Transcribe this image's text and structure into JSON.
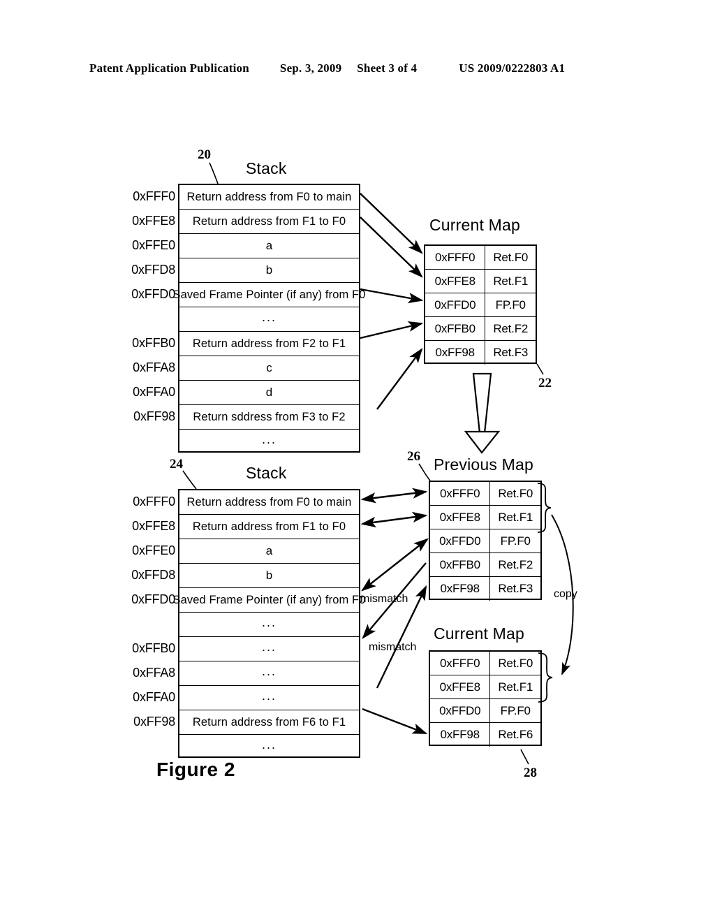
{
  "header": {
    "publication": "Patent Application Publication",
    "date": "Sep. 3, 2009",
    "sheet": "Sheet 3 of 4",
    "doc_number": "US 2009/0222803 A1"
  },
  "figure": {
    "caption": "Figure 2"
  },
  "top_stack": {
    "title": "Stack",
    "ref": "20",
    "rows": [
      {
        "addr": "0xFFF0",
        "text": "Return address from F0 to main"
      },
      {
        "addr": "0xFFE8",
        "text": "Return address from F1 to F0"
      },
      {
        "addr": "0xFFE0",
        "text": "a"
      },
      {
        "addr": "0xFFD8",
        "text": "b"
      },
      {
        "addr": "0xFFD0",
        "text": "Saved Frame Pointer (if any) from F0"
      },
      {
        "addr": "",
        "text": "..."
      },
      {
        "addr": "0xFFB0",
        "text": "Return address from F2 to F1"
      },
      {
        "addr": "0xFFA8",
        "text": "c"
      },
      {
        "addr": "0xFFA0",
        "text": "d"
      },
      {
        "addr": "0xFF98",
        "text": "Return sddress from F3 to F2"
      },
      {
        "addr": "",
        "text": "..."
      }
    ]
  },
  "top_current_map": {
    "title": "Current Map",
    "ref": "22",
    "rows": [
      {
        "addr": "0xFFF0",
        "value": "Ret.F0"
      },
      {
        "addr": "0xFFE8",
        "value": "Ret.F1"
      },
      {
        "addr": "0xFFD0",
        "value": "FP.F0"
      },
      {
        "addr": "0xFFB0",
        "value": "Ret.F2"
      },
      {
        "addr": "0xFF98",
        "value": "Ret.F3"
      }
    ]
  },
  "bottom_stack": {
    "title": "Stack",
    "ref": "24",
    "rows": [
      {
        "addr": "0xFFF0",
        "text": "Return address from F0 to main"
      },
      {
        "addr": "0xFFE8",
        "text": "Return address from F1 to F0"
      },
      {
        "addr": "0xFFE0",
        "text": "a"
      },
      {
        "addr": "0xFFD8",
        "text": "b"
      },
      {
        "addr": "0xFFD0",
        "text": "Saved Frame Pointer (if any) from F0"
      },
      {
        "addr": "",
        "text": "..."
      },
      {
        "addr": "0xFFB0",
        "text": "..."
      },
      {
        "addr": "0xFFA8",
        "text": "..."
      },
      {
        "addr": "0xFFA0",
        "text": "..."
      },
      {
        "addr": "0xFF98",
        "text": "Return address from F6 to F1"
      },
      {
        "addr": "",
        "text": "..."
      }
    ]
  },
  "previous_map": {
    "title": "Previous Map",
    "ref": "26",
    "rows": [
      {
        "addr": "0xFFF0",
        "value": "Ret.F0"
      },
      {
        "addr": "0xFFE8",
        "value": "Ret.F1"
      },
      {
        "addr": "0xFFD0",
        "value": "FP.F0"
      },
      {
        "addr": "0xFFB0",
        "value": "Ret.F2"
      },
      {
        "addr": "0xFF98",
        "value": "Ret.F3"
      }
    ]
  },
  "bottom_current_map": {
    "title": "Current Map",
    "ref": "28",
    "rows": [
      {
        "addr": "0xFFF0",
        "value": "Ret.F0"
      },
      {
        "addr": "0xFFE8",
        "value": "Ret.F1"
      },
      {
        "addr": "0xFFD0",
        "value": "FP.F0"
      },
      {
        "addr": "0xFF98",
        "value": "Ret.F6"
      }
    ]
  },
  "annotations": {
    "mismatch_upper": "mismatch",
    "mismatch_lower": "mismatch",
    "copy": "copy"
  }
}
